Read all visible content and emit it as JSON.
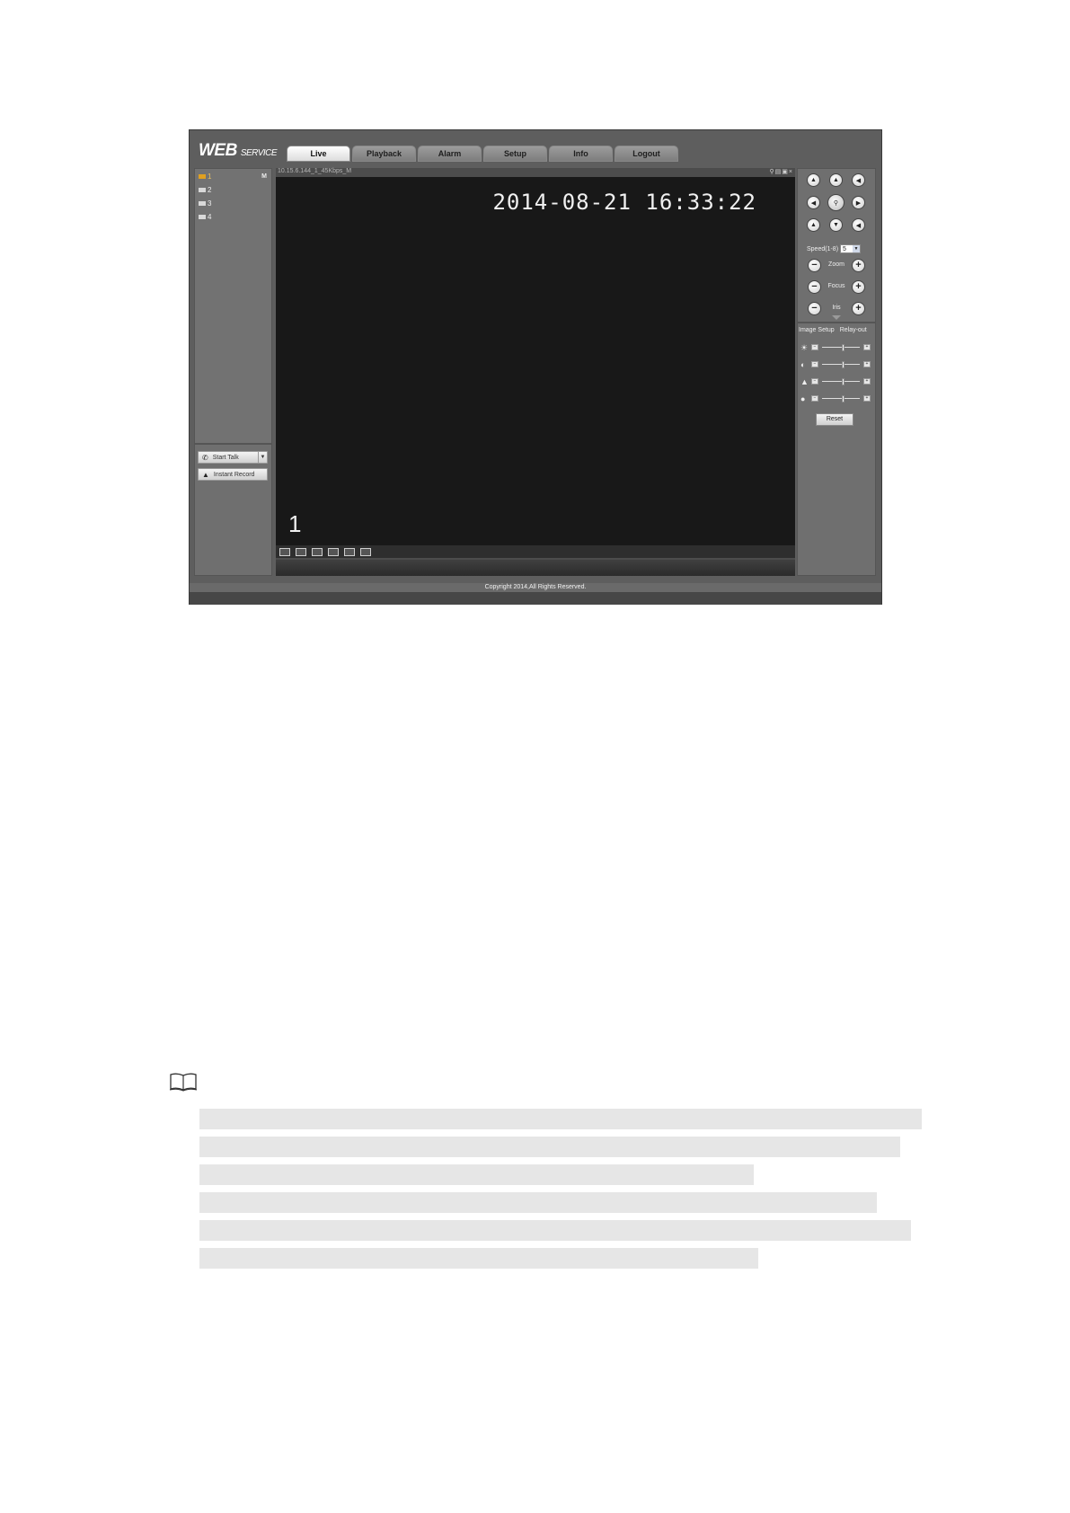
{
  "logo": {
    "main": "WEB",
    "sub": "SERVICE"
  },
  "tabs": [
    {
      "label": "Live",
      "active": true
    },
    {
      "label": "Playback",
      "active": false
    },
    {
      "label": "Alarm",
      "active": false
    },
    {
      "label": "Setup",
      "active": false
    },
    {
      "label": "Info",
      "active": false
    },
    {
      "label": "Logout",
      "active": false
    }
  ],
  "channels": [
    {
      "label": "1",
      "active": true
    },
    {
      "label": "2",
      "active": false
    },
    {
      "label": "3",
      "active": false
    },
    {
      "label": "4",
      "active": false
    }
  ],
  "channel_badge": "M",
  "left_buttons": {
    "start_talk": "Start Talk",
    "instant_record": "Instant Record"
  },
  "video": {
    "info": "10.15.6.144_1_45Kbps_M",
    "osd_time": "2014-08-21 16:33:22",
    "osd_channel": "1"
  },
  "ptz": {
    "speed_label": "Speed(1-8)",
    "speed_value": "5",
    "zoom_label": "Zoom",
    "focus_label": "Focus",
    "iris_label": "Iris"
  },
  "image_setup": {
    "tab1": "Image Setup",
    "tab2": "Relay-out",
    "sliders": [
      {
        "icon": "brightness-icon",
        "level": 0.55
      },
      {
        "icon": "contrast-icon",
        "level": 0.55
      },
      {
        "icon": "saturation-icon",
        "level": 0.55
      },
      {
        "icon": "hue-icon",
        "level": 0.55
      }
    ],
    "reset_label": "Reset"
  },
  "footer": "Copyright 2014,All Rights Reserved."
}
